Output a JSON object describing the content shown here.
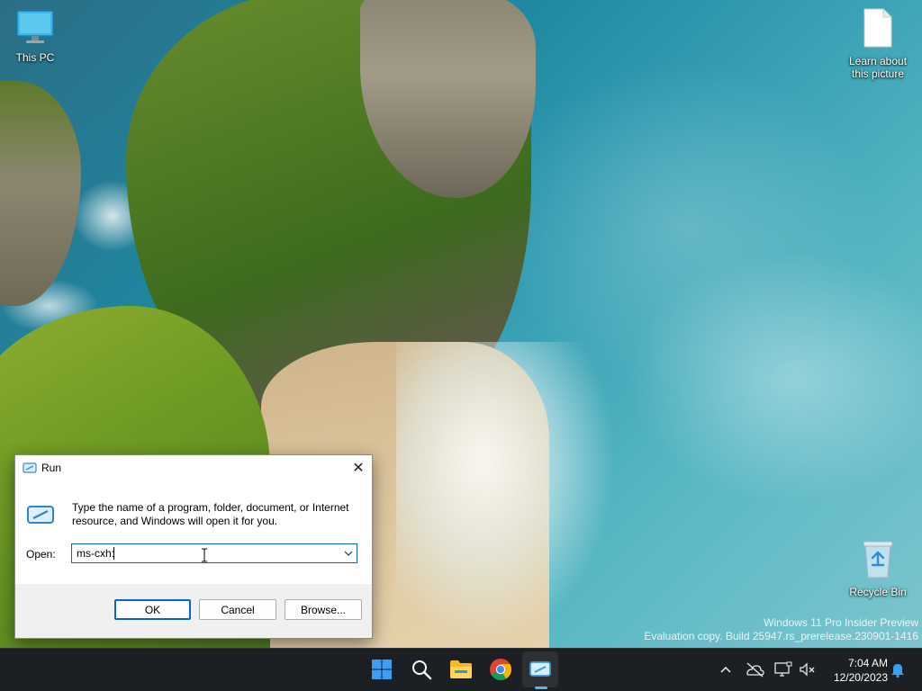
{
  "desktop": {
    "icons": [
      {
        "label": "This PC"
      },
      {
        "label": "Learn about this picture"
      },
      {
        "label": "Recycle Bin"
      }
    ],
    "watermark": {
      "line1": "Windows 11 Pro Insider Preview",
      "line2": "Evaluation copy. Build 25947.rs_prerelease.230901-1416"
    }
  },
  "run_dialog": {
    "title": "Run",
    "close_symbol": "✕",
    "description": "Type the name of a program, folder, document, or Internet resource, and Windows will open it for you.",
    "open_label": "Open:",
    "input_value": "ms-cxh:",
    "buttons": {
      "ok": "OK",
      "cancel": "Cancel",
      "browse": "Browse..."
    }
  },
  "taskbar": {
    "apps": [
      "start-icon",
      "search-icon",
      "file-explorer-icon",
      "chrome-icon",
      "run-icon"
    ],
    "clock": {
      "time": "7:04 AM",
      "date": "12/20/2023"
    }
  },
  "colors": {
    "accent": "#0a64c8",
    "taskbar": "#1c1f24",
    "run_indicator": "#5fb2f2"
  }
}
